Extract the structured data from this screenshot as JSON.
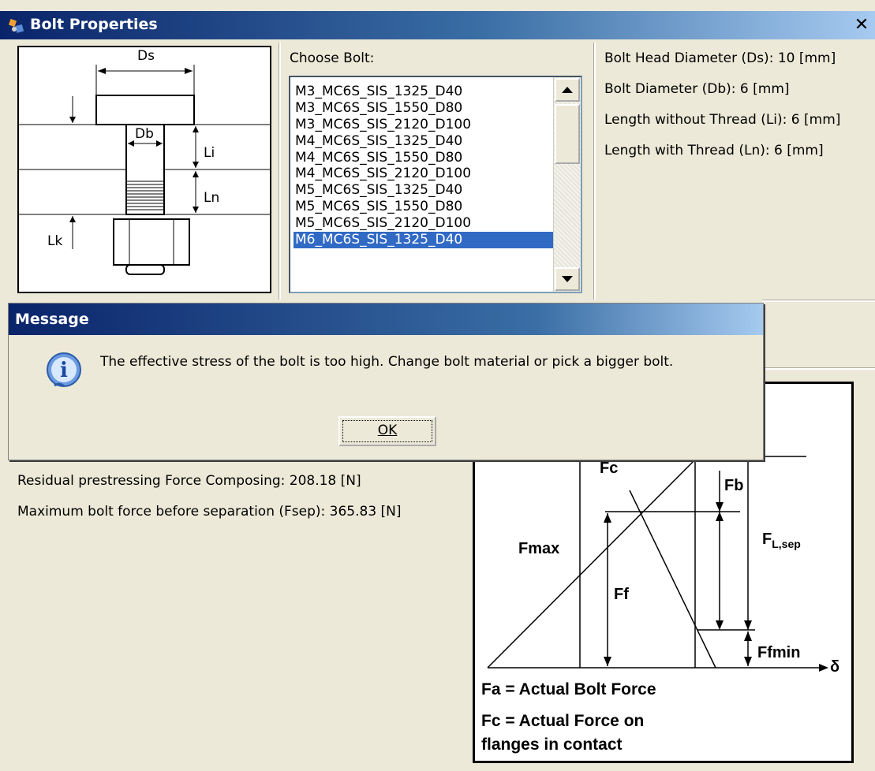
{
  "window": {
    "title": "Bolt Properties",
    "close_label": "✕"
  },
  "diagram": {
    "labels": {
      "ds": "Ds",
      "db": "Db",
      "li": "Li",
      "ln": "Ln",
      "lk": "Lk"
    }
  },
  "choose": {
    "label": "Choose Bolt:",
    "items": [
      "M3_MC6S_SIS_1325_D40",
      "M3_MC6S_SIS_1550_D80",
      "M3_MC6S_SIS_2120_D100",
      "M4_MC6S_SIS_1325_D40",
      "M4_MC6S_SIS_1550_D80",
      "M4_MC6S_SIS_2120_D100",
      "M5_MC6S_SIS_1325_D40",
      "M5_MC6S_SIS_1550_D80",
      "M5_MC6S_SIS_2120_D100",
      "M6_MC6S_SIS_1325_D40"
    ],
    "selected": "M6_MC6S_SIS_1325_D40"
  },
  "props": {
    "head_diameter": "Bolt Head Diameter (Ds): 10 [mm]",
    "bolt_diameter": "Bolt Diameter (Db): 6 [mm]",
    "len_without": "Length without Thread (Li): 6 [mm]",
    "len_with": "Length with Thread (Ln): 6 [mm]"
  },
  "results": {
    "residual": "Residual prestressing Force Composing: 208.18 [N]",
    "max_force": "Maximum bolt force before separation (Fsep): 365.83 [N]"
  },
  "force_diagram": {
    "fc": "Fc",
    "fb": "Fb",
    "fmax": "Fmax",
    "ff": "Ff",
    "fl_main": "F",
    "fl_sub": "L,sep",
    "ffmin": "Ffmin",
    "delta": "δ",
    "legend_fa": "Fa = Actual Bolt Force",
    "legend_fc1": "Fc = Actual Force on",
    "legend_fc2": "flanges in contact"
  },
  "message": {
    "title": "Message",
    "text": "The effective stress of the bolt is too high. Change bolt material or pick a bigger bolt.",
    "ok_label": "OK"
  },
  "colors": {
    "selection": "#316ac5",
    "titlebar": "#0a246a"
  }
}
